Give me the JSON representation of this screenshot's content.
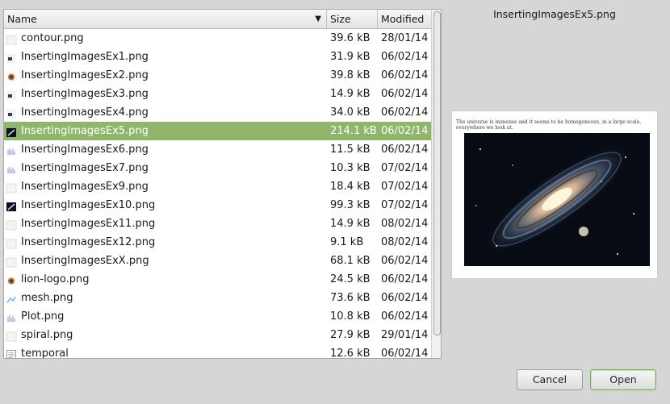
{
  "columns": {
    "name": "Name",
    "size": "Size",
    "modified": "Modified"
  },
  "files": [
    {
      "name": "contour.png",
      "size": "39.6 kB",
      "modified": "28/01/14",
      "icon": "blank-thumb-icon"
    },
    {
      "name": "InsertingImagesEx1.png",
      "size": "31.9 kB",
      "modified": "06/02/14",
      "icon": "image-thumb-icon"
    },
    {
      "name": "InsertingImagesEx2.png",
      "size": "39.8 kB",
      "modified": "06/02/14",
      "icon": "lion-thumb-icon"
    },
    {
      "name": "InsertingImagesEx3.png",
      "size": "14.9 kB",
      "modified": "06/02/14",
      "icon": "image-thumb-icon"
    },
    {
      "name": "InsertingImagesEx4.png",
      "size": "34.0 kB",
      "modified": "06/02/14",
      "icon": "image-thumb-icon"
    },
    {
      "name": "InsertingImagesEx5.png",
      "size": "214.1 kB",
      "modified": "06/02/14",
      "icon": "galaxy-thumb-icon",
      "selected": true
    },
    {
      "name": "InsertingImagesEx6.png",
      "size": "11.5 kB",
      "modified": "06/02/14",
      "icon": "plot-thumb-icon"
    },
    {
      "name": "InsertingImagesEx7.png",
      "size": "10.3 kB",
      "modified": "07/02/14",
      "icon": "plot-thumb-icon"
    },
    {
      "name": "InsertingImagesEx9.png",
      "size": "18.4 kB",
      "modified": "07/02/14",
      "icon": "blank-thumb-icon"
    },
    {
      "name": "InsertingImagesEx10.png",
      "size": "99.3 kB",
      "modified": "07/02/14",
      "icon": "galaxy-thumb-icon"
    },
    {
      "name": "InsertingImagesEx11.png",
      "size": "14.9 kB",
      "modified": "08/02/14",
      "icon": "blank-thumb-icon"
    },
    {
      "name": "InsertingImagesEx12.png",
      "size": "9.1 kB",
      "modified": "08/02/14",
      "icon": "blank-thumb-icon"
    },
    {
      "name": "InsertingImagesExX.png",
      "size": "68.1 kB",
      "modified": "06/02/14",
      "icon": "blank-thumb-icon"
    },
    {
      "name": "lion-logo.png",
      "size": "24.5 kB",
      "modified": "06/02/14",
      "icon": "lion-thumb-icon"
    },
    {
      "name": "mesh.png",
      "size": "73.6 kB",
      "modified": "06/02/14",
      "icon": "mesh-thumb-icon"
    },
    {
      "name": "Plot.png",
      "size": "10.8 kB",
      "modified": "06/02/14",
      "icon": "plot-thumb-icon"
    },
    {
      "name": "spiral.png",
      "size": "27.9 kB",
      "modified": "29/01/14",
      "icon": "blank-thumb-icon"
    },
    {
      "name": "temporal",
      "size": "12.6 kB",
      "modified": "06/02/14",
      "icon": "text-file-icon"
    }
  ],
  "preview": {
    "title": "InsertingImagesEx5.png",
    "text": "The universe is immense and it seems to be homogeneous, in a large scale, everywhere we look at."
  },
  "buttons": {
    "cancel": "Cancel",
    "open": "Open"
  },
  "colors": {
    "selection": "#8fb66a",
    "accent_border": "#7ea85a"
  }
}
